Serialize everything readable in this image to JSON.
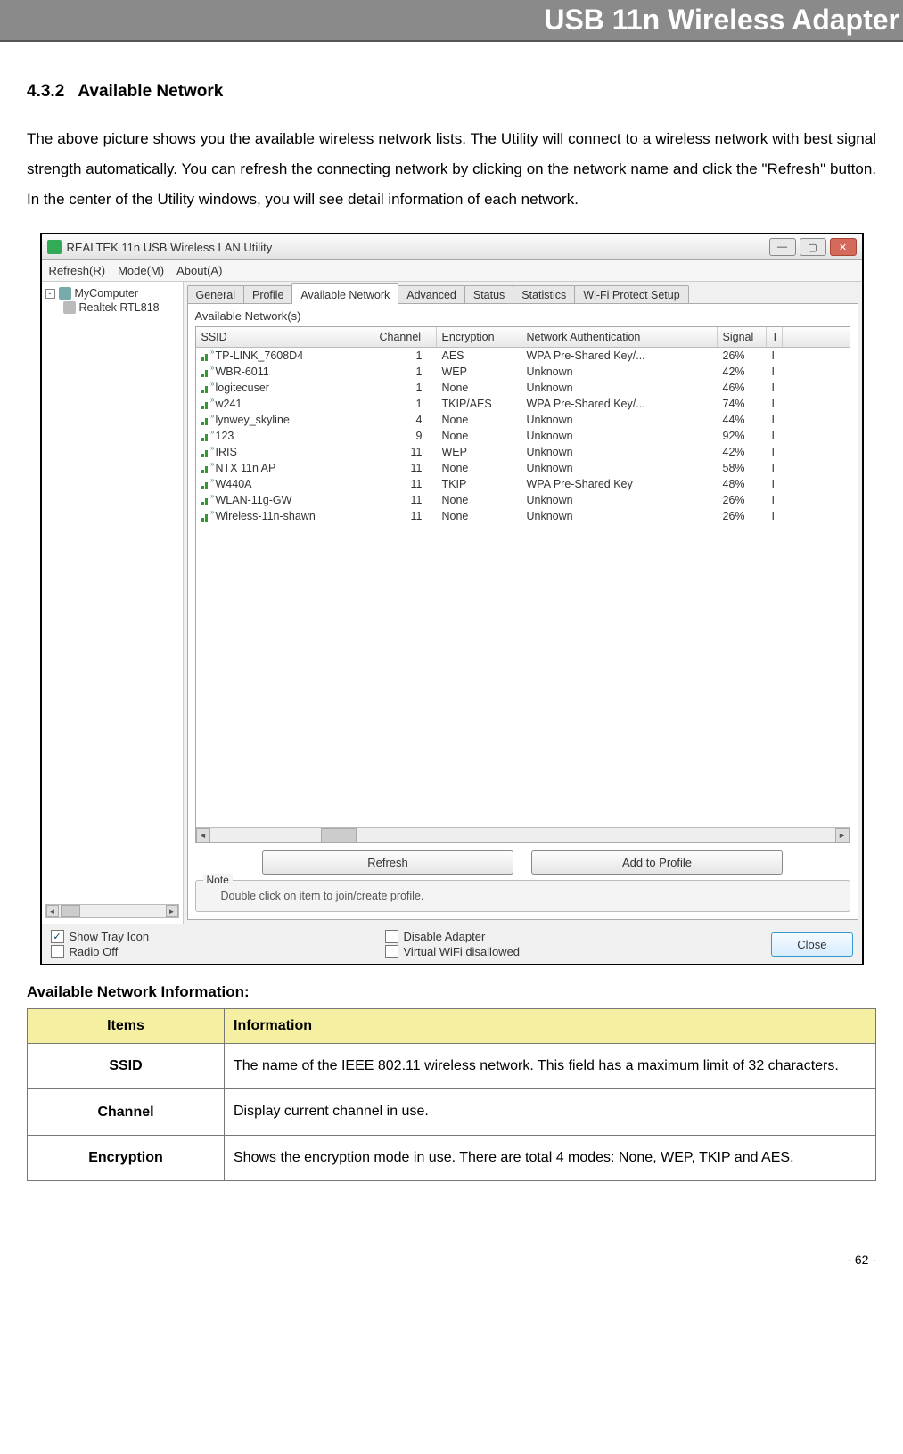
{
  "header_title": "USB 11n Wireless Adapter",
  "section_number": "4.3.2",
  "section_title": "Available Network",
  "paragraph": "The above picture shows you the available wireless network lists. The Utility will connect to a wireless network with best signal strength automatically. You can refresh the connecting network by clicking on the network name and click the \"Refresh\" button. In the center of the Utility windows, you will see detail information of each network.",
  "app": {
    "window_title": "REALTEK 11n USB Wireless LAN Utility",
    "menu": {
      "refresh": "Refresh(R)",
      "mode": "Mode(M)",
      "about": "About(A)"
    },
    "tree": {
      "root": "MyComputer",
      "child": "Realtek RTL818"
    },
    "tabs": {
      "general": "General",
      "profile": "Profile",
      "available_network": "Available Network",
      "advanced": "Advanced",
      "status": "Status",
      "statistics": "Statistics",
      "wps": "Wi-Fi Protect Setup"
    },
    "panel_label": "Available Network(s)",
    "columns": {
      "ssid": "SSID",
      "channel": "Channel",
      "encryption": "Encryption",
      "auth": "Network Authentication",
      "signal": "Signal",
      "extra": "T"
    },
    "networks": [
      {
        "ssid": "TP-LINK_7608D4",
        "channel": "1",
        "encryption": "AES",
        "auth": "WPA Pre-Shared Key/...",
        "signal": "26%",
        "extra": "I"
      },
      {
        "ssid": "WBR-6011",
        "channel": "1",
        "encryption": "WEP",
        "auth": "Unknown",
        "signal": "42%",
        "extra": "I"
      },
      {
        "ssid": "logitecuser",
        "channel": "1",
        "encryption": "None",
        "auth": "Unknown",
        "signal": "46%",
        "extra": "I"
      },
      {
        "ssid": "w241",
        "channel": "1",
        "encryption": "TKIP/AES",
        "auth": "WPA Pre-Shared Key/...",
        "signal": "74%",
        "extra": "I"
      },
      {
        "ssid": "lynwey_skyline",
        "channel": "4",
        "encryption": "None",
        "auth": "Unknown",
        "signal": "44%",
        "extra": "I"
      },
      {
        "ssid": "123",
        "channel": "9",
        "encryption": "None",
        "auth": "Unknown",
        "signal": "92%",
        "extra": "I"
      },
      {
        "ssid": "IRIS",
        "channel": "11",
        "encryption": "WEP",
        "auth": "Unknown",
        "signal": "42%",
        "extra": "I"
      },
      {
        "ssid": "NTX 11n AP",
        "channel": "11",
        "encryption": "None",
        "auth": "Unknown",
        "signal": "58%",
        "extra": "I"
      },
      {
        "ssid": "W440A",
        "channel": "11",
        "encryption": "TKIP",
        "auth": "WPA Pre-Shared Key",
        "signal": "48%",
        "extra": "I"
      },
      {
        "ssid": "WLAN-11g-GW",
        "channel": "11",
        "encryption": "None",
        "auth": "Unknown",
        "signal": "26%",
        "extra": "I"
      },
      {
        "ssid": "Wireless-11n-shawn",
        "channel": "11",
        "encryption": "None",
        "auth": "Unknown",
        "signal": "26%",
        "extra": "I"
      }
    ],
    "buttons": {
      "refresh": "Refresh",
      "add_profile": "Add to Profile"
    },
    "note_legend": "Note",
    "note_text": "Double click on item to join/create profile.",
    "options": {
      "show_tray": "Show Tray Icon",
      "radio_off": "Radio Off",
      "disable_adapter": "Disable Adapter",
      "virtual_wifi": "Virtual WiFi disallowed"
    },
    "close": "Close"
  },
  "subheading": "Available Network Information:",
  "info_table": {
    "head_items": "Items",
    "head_info": "Information",
    "rows": [
      {
        "item": "SSID",
        "desc": "The name of the IEEE 802.11 wireless network. This field has a maximum limit of 32 characters."
      },
      {
        "item": "Channel",
        "desc": "Display current channel in use."
      },
      {
        "item": "Encryption",
        "desc": "Shows the encryption mode in use. There are total 4 modes: None, WEP, TKIP and AES."
      }
    ]
  },
  "page_number": "- 62 -"
}
